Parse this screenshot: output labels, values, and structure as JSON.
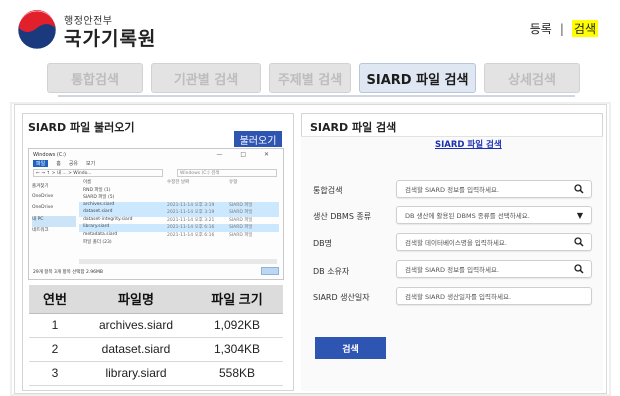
{
  "header": {
    "org_small": "행정안전부",
    "org_big": "국가기록원",
    "login": "등록",
    "separator": "|",
    "search": "검색"
  },
  "tabs": [
    {
      "label": "통합검색",
      "active": false
    },
    {
      "label": "기관별 검색",
      "active": false
    },
    {
      "label": "주제별 검색",
      "active": false
    },
    {
      "label": "SIARD 파일 검색",
      "active": true
    },
    {
      "label": "상세검색",
      "active": false
    }
  ],
  "left_panel": {
    "title": "SIARD 파일 불러오기",
    "load_button": "불러오기",
    "explorer": {
      "title": "Windows (C:)",
      "window_buttons": "— □ ✕",
      "ribbon": [
        "파일",
        "홈",
        "공유",
        "보기"
      ],
      "address": "← → ↑  > 내 ... > Windo...",
      "search_placeholder": "Windows (C:) 검색",
      "nav": [
        "즐겨찾기",
        "OneDrive",
        "OneDrive",
        "내 PC",
        "네트워크"
      ],
      "header": [
        "이름",
        "수정한 날짜",
        "유형"
      ],
      "rows": [
        {
          "name": "RND 파일 (1)",
          "date": "",
          "type": "",
          "selected": false
        },
        {
          "name": "SIARD 파일 (5)",
          "date": "",
          "type": "",
          "selected": false
        },
        {
          "name": "archives.siard",
          "date": "2021-11-14 오후 3:19",
          "type": "SIARD 파일",
          "selected": true
        },
        {
          "name": "dataset.siard",
          "date": "2021-11-14 오후 3:19",
          "type": "SIARD 파일",
          "selected": true
        },
        {
          "name": "dataset-integrity.siard",
          "date": "2021-11-14 오후 3:21",
          "type": "SIARD 파일",
          "selected": false
        },
        {
          "name": "library.siard",
          "date": "2021-11-14 오후 6:16",
          "type": "SIARD 파일",
          "selected": true
        },
        {
          "name": "metadata.siard",
          "date": "2021-11-14 오후 6:16",
          "type": "SIARD 파일",
          "selected": false
        },
        {
          "name": "파일 폴더 (23)",
          "date": "",
          "type": "",
          "selected": false
        }
      ],
      "status": "29개 항목    3개 항목 선택함 2.96MB"
    },
    "table": {
      "headers": [
        "연번",
        "파일명",
        "파일 크기"
      ],
      "rows": [
        [
          "1",
          "archives.siard",
          "1,092KB"
        ],
        [
          "2",
          "dataset.siard",
          "1,304KB"
        ],
        [
          "3",
          "library.siard",
          "558KB"
        ]
      ]
    }
  },
  "right_panel": {
    "title": "SIARD 파일 검색",
    "link": "SIARD 파일 검색",
    "fields": [
      {
        "label": "통합검색",
        "placeholder": "검색할 SIARD 정보를 입력하세요.",
        "icon": "search-icon"
      },
      {
        "label": "생산 DBMS 종류",
        "placeholder": "DB 생산에 활용된 DBMS 종류를 선택하세요.",
        "icon": "chevron-down-icon"
      },
      {
        "label": "DB명",
        "placeholder": "검색할 데이터베이스명을 입력하세요.",
        "icon": "search-icon"
      },
      {
        "label": "DB 소유자",
        "placeholder": "검색할 SIARD 정보를 입력하세요.",
        "icon": "search-icon"
      },
      {
        "label": "SIARD 생산일자",
        "placeholder": "검색할 SIARD 생산일자를 입력하세요.",
        "icon": ""
      }
    ],
    "search_button": "검색"
  },
  "colors": {
    "accent_blue": "#2f55b3",
    "highlight": "#ffff00",
    "link": "#1a2fb5"
  }
}
